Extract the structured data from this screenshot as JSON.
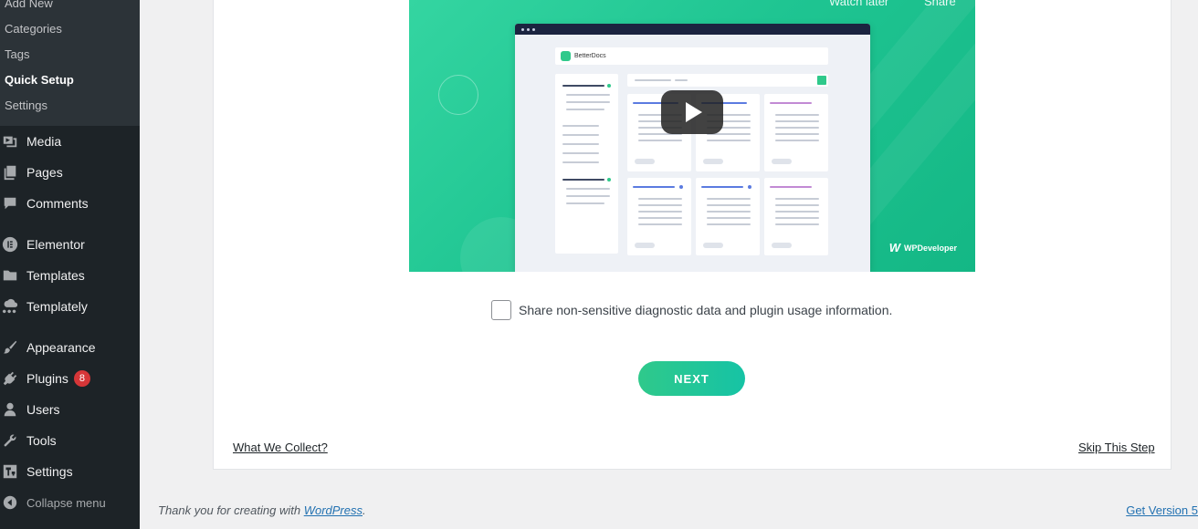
{
  "sidebar": {
    "submenu": [
      {
        "label": "Add New",
        "current": false
      },
      {
        "label": "Categories",
        "current": false
      },
      {
        "label": "Tags",
        "current": false
      },
      {
        "label": "Quick Setup",
        "current": true
      },
      {
        "label": "Settings",
        "current": false
      }
    ],
    "items": [
      {
        "label": "Media",
        "icon": "media-icon"
      },
      {
        "label": "Pages",
        "icon": "pages-icon"
      },
      {
        "label": "Comments",
        "icon": "comments-icon"
      },
      {
        "label": "Elementor",
        "icon": "elementor-icon"
      },
      {
        "label": "Templates",
        "icon": "folder-icon"
      },
      {
        "label": "Templately",
        "icon": "templately-icon"
      },
      {
        "label": "Appearance",
        "icon": "paintbrush-icon"
      },
      {
        "label": "Plugins",
        "icon": "plugin-icon",
        "badge": "8"
      },
      {
        "label": "Users",
        "icon": "user-icon"
      },
      {
        "label": "Tools",
        "icon": "wrench-icon"
      },
      {
        "label": "Settings",
        "icon": "settings-icon"
      }
    ],
    "collapse_label": "Collapse menu"
  },
  "video": {
    "top_left_text": "Watch later",
    "top_right_text": "Share",
    "app_name": "BetterDocs",
    "brand": "WPDeveloper",
    "brand_mark": "W"
  },
  "consent": {
    "label": "Share non-sensitive diagnostic data and plugin usage information.",
    "checked": false
  },
  "next_label": "NEXT",
  "what_we_collect_label": "What We Collect?",
  "skip_label": "Skip This Step",
  "footer": {
    "thanks_prefix": "Thank you for creating with ",
    "wordpress_link": "WordPress",
    "thanks_suffix": ".",
    "version_link": "Get Version 5"
  },
  "colors": {
    "sidebar_bg": "#1d2327",
    "accent_green": "#2fc98b",
    "link_blue": "#2271b1",
    "badge_red": "#d63638"
  }
}
